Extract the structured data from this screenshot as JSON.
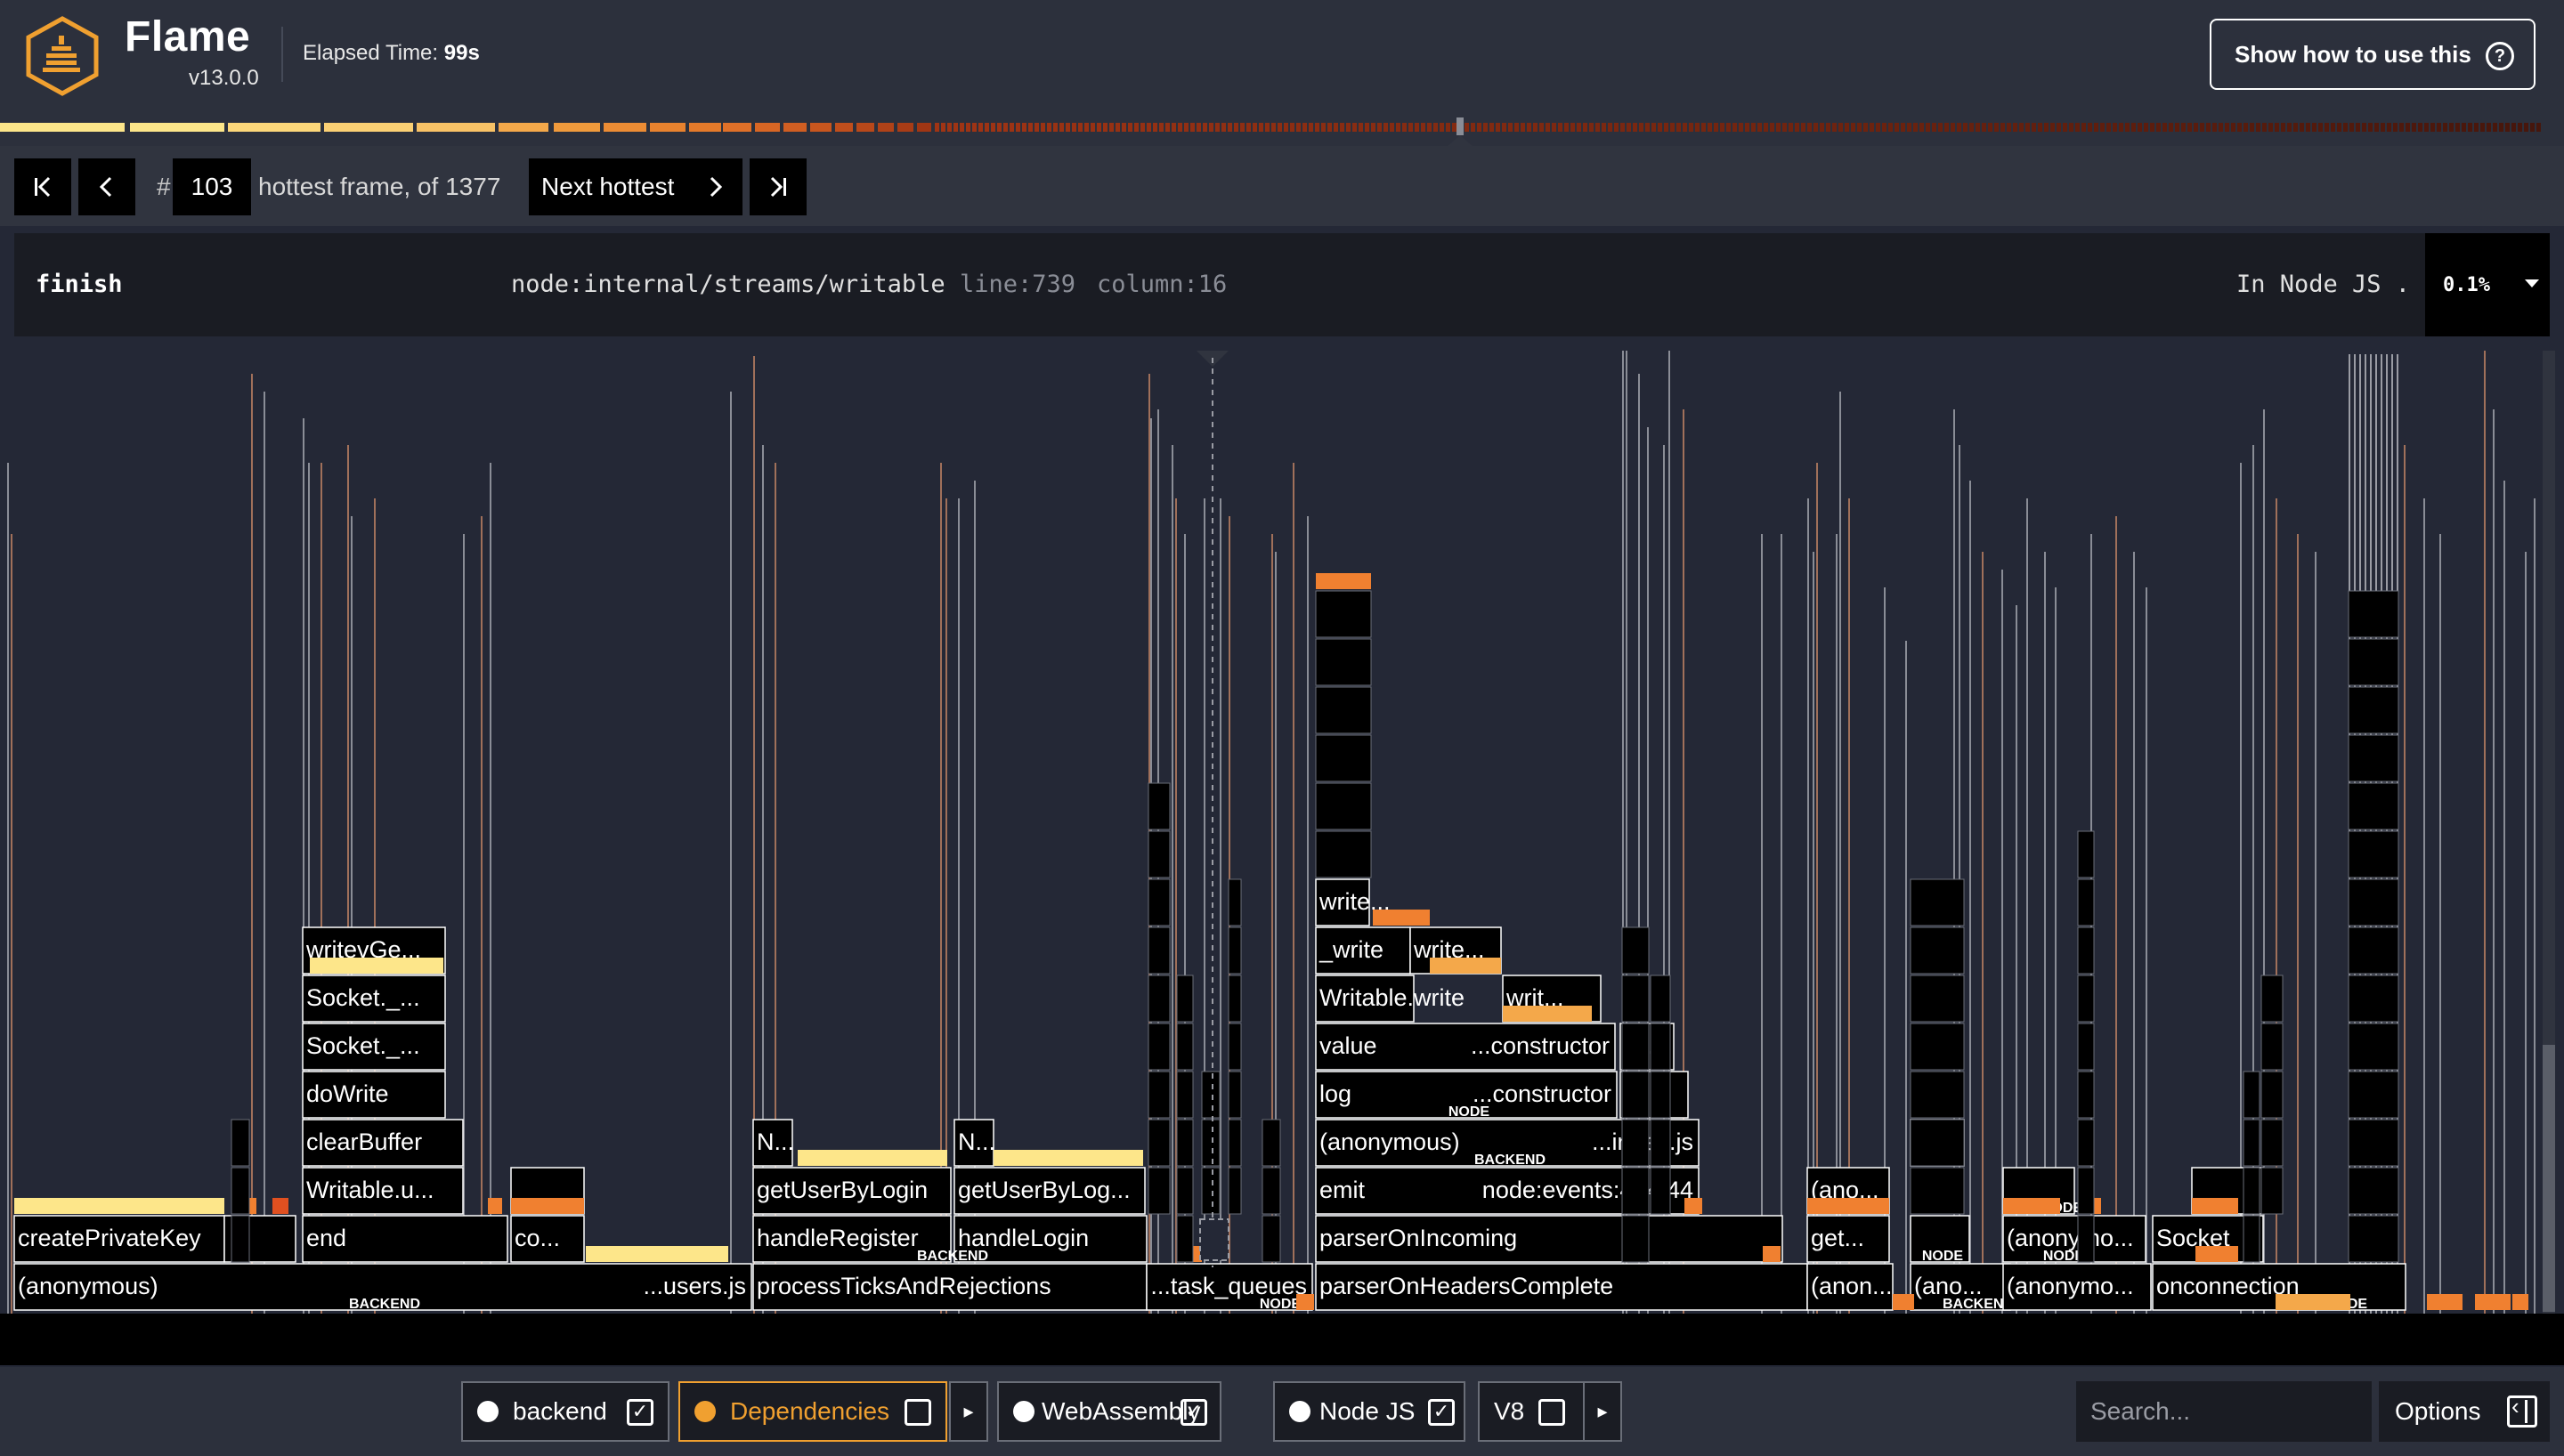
{
  "header": {
    "app_name": "Flame",
    "version": "v13.0.0",
    "elapsed_label": "Elapsed Time:",
    "elapsed_value": "99s",
    "help_button": "Show how to use this",
    "help_icon_glyph": "?"
  },
  "nav": {
    "first_icon": "first-frame-icon",
    "prev_icon": "prev-frame-icon",
    "hash": "#",
    "frame_number": "103",
    "hottest_text": "hottest frame, of 1377",
    "next_hottest_label": "Next hottest",
    "last_icon": "last-frame-icon"
  },
  "selected_frame": {
    "name": "finish",
    "file": "node:internal/streams/writable",
    "line": "line:739",
    "column": "column:16",
    "type": "In Node JS .",
    "percent": "0.1%"
  },
  "flame_labels": {
    "createPrivateKey": "createPrivateKey",
    "anonymous_root": "(anonymous)",
    "users_js": "...users.js",
    "writevGe": "writevGe...",
    "socket1": "Socket._...",
    "socket2": "Socket._...",
    "doWrite": "doWrite",
    "clearBuffer": "clearBuffer",
    "writableU": "Writable.u...",
    "end": "end",
    "co": "co...",
    "getUserByLogin": "getUserByLogin",
    "getUserByLog2": "getUserByLog...",
    "handleRegister": "handleRegister",
    "handleLogin": "handleLogin",
    "processTicks": "processTicksAndRejections",
    "taskQueues": "...task_queues",
    "n1": "N...",
    "n2": "N...",
    "n3": "N...",
    "write1": "write...",
    "write_": "_write",
    "write2": "write...",
    "writableWrite": "Writable.write",
    "writ": "writ...",
    "value": "value",
    "constructor1": "...constructor",
    "log": "log",
    "constructor2": "...constructor",
    "anonymous2": "(anonymous)",
    "indexJs": "...index.js",
    "emit": "emit",
    "nodeEvents": "node:events:464:44",
    "parserOnIncoming": "parserOnIncoming",
    "parserOnHeaders": "parserOnHeadersComplete",
    "ano1": "(ano...",
    "get": "get...",
    "anon1": "(anon...",
    "ano2": "(ano...",
    "anonymo1": "(anonymo...",
    "anonymo2": "(anonymo...",
    "socket": "Socket",
    "onconnection": "onconnection",
    "tag_node": "NODE",
    "tag_backend": "BACKEND"
  },
  "legend": {
    "backend": "backend",
    "dependencies": "Dependencies",
    "webassembly": "WebAssembly",
    "nodejs": "Node JS",
    "v8": "V8",
    "checkmark": "✓",
    "arrow": "▸",
    "active_color": "#f0a030"
  },
  "search": {
    "placeholder": "Search..."
  },
  "options": {
    "label": "Options"
  },
  "colors": {
    "background": "#242836",
    "frame_fill": "#000000",
    "hot_yellow": "#fde68a",
    "hot_orange": "#f08030",
    "hot_red": "#e05020"
  }
}
